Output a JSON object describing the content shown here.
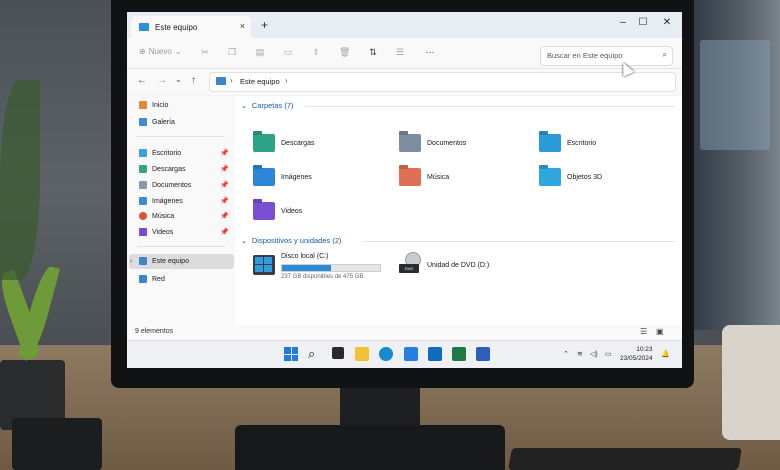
{
  "window": {
    "tab_title": "Este equipo",
    "tab_close": "×",
    "new_tab": "+",
    "minimize": "–",
    "maximize": "☐",
    "close": "✕"
  },
  "commandbar": {
    "new_label": "Nuevo",
    "more": "···",
    "search_placeholder": "Buscar en Este equipo"
  },
  "address": {
    "segment": "Este equipo",
    "sep": "›"
  },
  "sidebar": {
    "items": [
      {
        "label": "Inicio",
        "color": "#e08a3a"
      },
      {
        "label": "Galería",
        "color": "#3f8cd6"
      },
      {
        "label": "Escritorio",
        "color": "#3aa0e0",
        "pinned": true
      },
      {
        "label": "Descargas",
        "color": "#3ca27a",
        "pinned": true
      },
      {
        "label": "Documentos",
        "color": "#8a99a8",
        "pinned": true
      },
      {
        "label": "Imágenes",
        "color": "#3f8cd6",
        "pinned": true
      },
      {
        "label": "Música",
        "color": "#e0533a",
        "pinned": true
      },
      {
        "label": "Videos",
        "color": "#7a4ad2",
        "pinned": true
      },
      {
        "label": "Este equipo",
        "color": "#3a86c8"
      },
      {
        "label": "Red",
        "color": "#3a86c8"
      }
    ]
  },
  "content": {
    "folders_header": "Carpetas (7)",
    "folders": [
      {
        "label": "Descargas",
        "color": "#2fa28a"
      },
      {
        "label": "Documentos",
        "color": "#7d8ea2"
      },
      {
        "label": "Escritorio",
        "color": "#2a9ad8"
      },
      {
        "label": "Imágenes",
        "color": "#2f86d8"
      },
      {
        "label": "Música",
        "color": "#e07054"
      },
      {
        "label": "Objetos 3D",
        "color": "#2fa6de"
      },
      {
        "label": "Videos",
        "color": "#7b4fd4"
      }
    ],
    "drives_header": "Dispositivos y unidades (2)",
    "drives": [
      {
        "label": "Disco local (C:)",
        "detail": "237 GB disponibles de 475 GB",
        "used_fraction": 0.5
      },
      {
        "label": "Unidad de DVD (D:)"
      }
    ]
  },
  "status": {
    "count": "9 elementos"
  },
  "taskbar": {
    "time": "10:23",
    "date": "23/05/2024"
  }
}
